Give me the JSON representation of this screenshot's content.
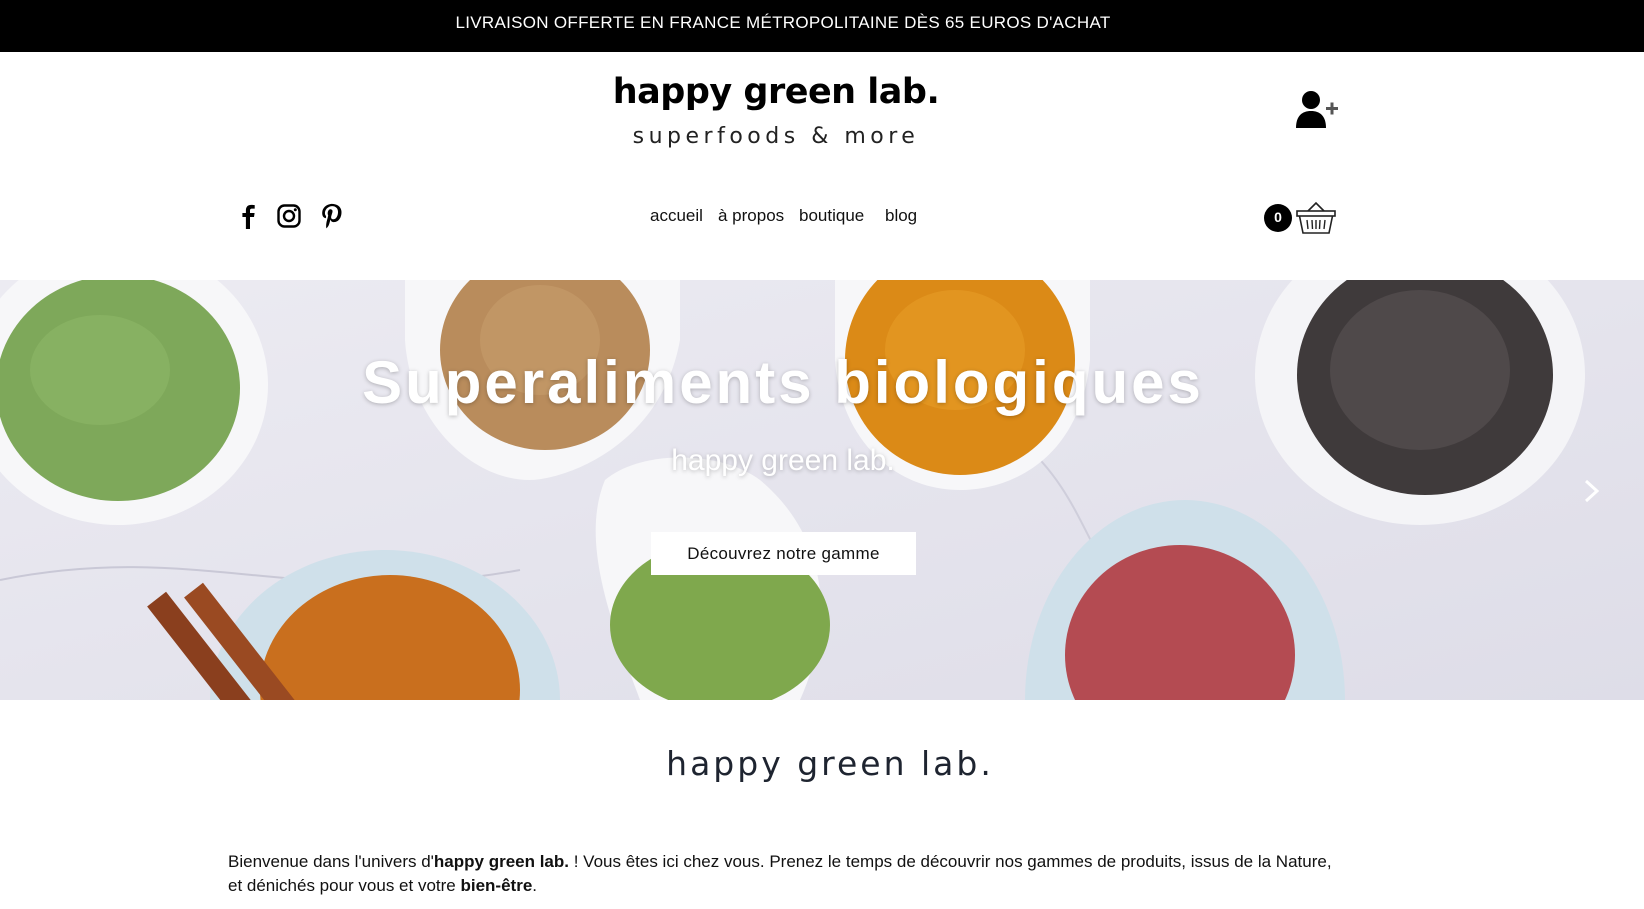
{
  "announcement": "LIVRAISON OFFERTE EN FRANCE MÉTROPOLITAINE DÈS 65 EUROS D'ACHAT",
  "brand": {
    "title": "happy green lab.",
    "tagline": "superfoods & more"
  },
  "header": {
    "account_icon": "user-plus-icon",
    "social": [
      "facebook-icon",
      "instagram-icon",
      "pinterest-icon"
    ],
    "nav": [
      "accueil",
      "à propos",
      "boutique",
      "blog"
    ],
    "cart_count": "0",
    "cart_icon": "basket-icon"
  },
  "hero": {
    "title": "Superaliments biologiques",
    "subtitle": "happy green lab.",
    "cta": "Découvrez notre gamme",
    "next_icon": "chevron-right-icon"
  },
  "section": {
    "title": "happy green lab.",
    "intro_1": "Bienvenue dans l'univers d'",
    "intro_bold_1": "happy green lab.",
    "intro_2": " ! Vous êtes ici chez vous. Prenez le temps de découvrir nos gammes de produits, issus de la Nature, et dénichés pour vous et votre ",
    "intro_bold_2": "bien-être",
    "intro_3": "."
  }
}
